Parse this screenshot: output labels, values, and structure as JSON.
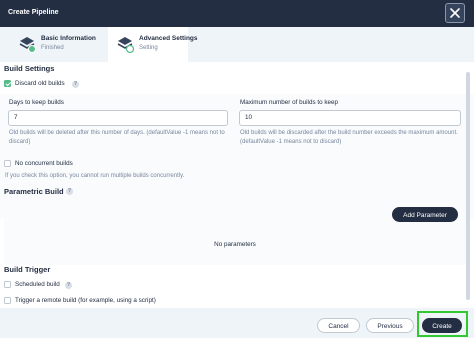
{
  "header": {
    "title": "Create Pipeline",
    "close_icon": "close-icon"
  },
  "steps": [
    {
      "name": "Basic Information",
      "status": "Finished",
      "icon": "layers-check-icon",
      "status_color": "#55bc8a"
    },
    {
      "name": "Advanced Settings",
      "status": "Setting",
      "icon": "layers-progress-icon",
      "status_color": "#ffffff"
    }
  ],
  "build_settings": {
    "title": "Build Settings",
    "discard_label": "Discard old builds",
    "discard_checked": true,
    "days_label": "Days to keep builds",
    "days_value": "7",
    "days_hint": "Old builds will be deleted after this number of days. (defaultValue -1 means not to discard)",
    "max_label": "Maximum number of builds to keep",
    "max_value": "10",
    "max_hint": "Old builds will be discarded after the build number exceeds the maximum amount. (defaultValue -1 means not to discard)",
    "concurrent_label": "No concurrent builds",
    "concurrent_checked": false,
    "concurrent_hint": "If you check this option, you cannot run multiple builds concurrently."
  },
  "parametric_build": {
    "title": "Parametric Build",
    "add_button": "Add Parameter",
    "empty_text": "No parameters"
  },
  "build_trigger": {
    "title": "Build Trigger",
    "scheduled_label": "Scheduled build",
    "remote_label": "Trigger a remote build (for example, using a script)"
  },
  "footer": {
    "cancel_label": "Cancel",
    "previous_label": "Previous",
    "create_label": "Create"
  },
  "colors": {
    "header_bg": "#242e42",
    "accent_green": "#55bc8a",
    "highlight": "#32c830"
  }
}
